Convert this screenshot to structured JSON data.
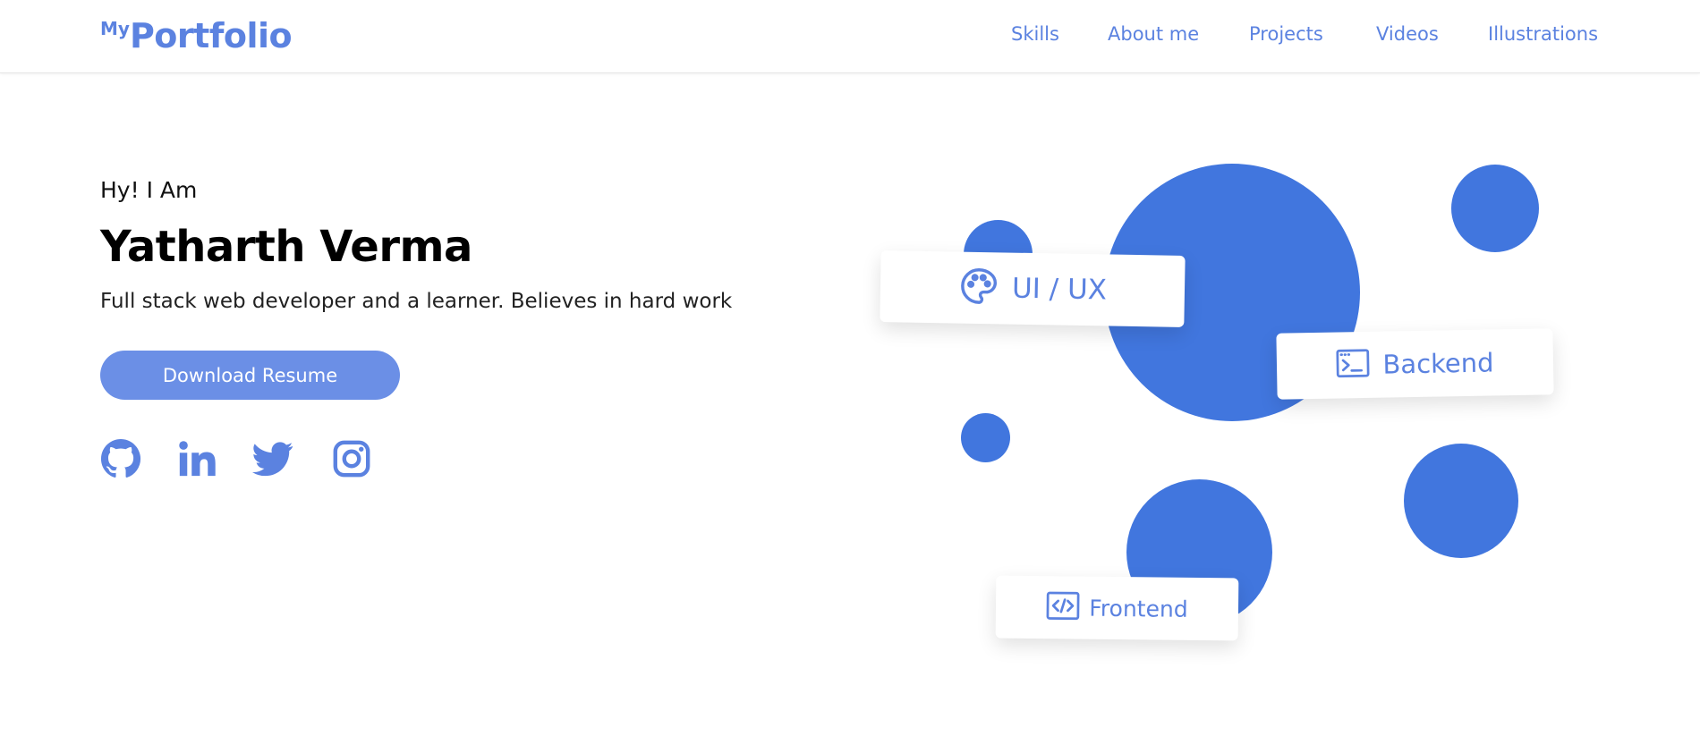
{
  "header": {
    "logo_small": "My",
    "logo_main": "Portfolio",
    "nav": [
      "Skills",
      "About me",
      "Projects",
      "Videos",
      "Illustrations"
    ]
  },
  "hero": {
    "greeting": "Hy! I Am",
    "name": "Yatharth Verma",
    "tagline": "Full stack web developer and a learner. Believes in hard work",
    "resume_button": "Download Resume",
    "social_icons": [
      "github-icon",
      "linkedin-icon",
      "twitter-icon",
      "instagram-icon"
    ]
  },
  "skills_cards": [
    {
      "label": "UI / UX",
      "icon": "palette-icon"
    },
    {
      "label": "Backend",
      "icon": "terminal-icon"
    },
    {
      "label": "Frontend",
      "icon": "code-icon"
    }
  ],
  "colors": {
    "accent": "#5b82e0",
    "button": "#6b8fe6",
    "blob": "#4176de"
  }
}
